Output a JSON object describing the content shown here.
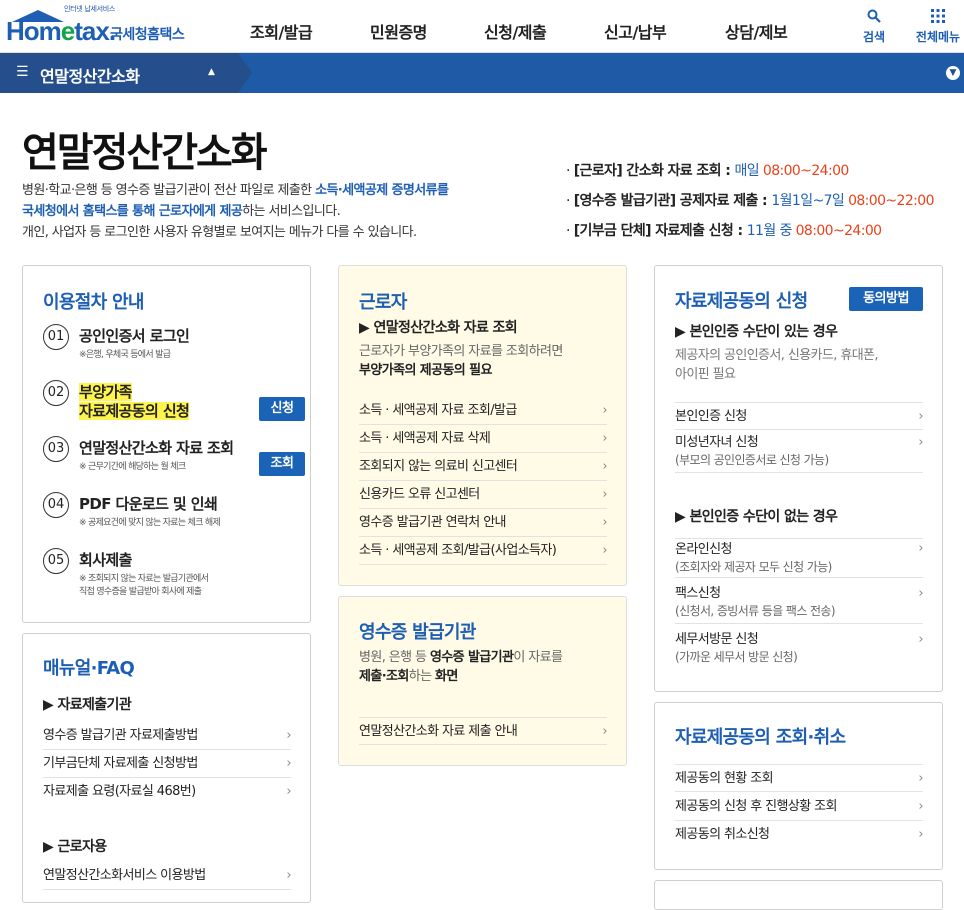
{
  "header": {
    "logo_small": "인터넷 납세서비스",
    "logo_brand_a": "Hom",
    "logo_brand_e": "e",
    "logo_brand_b": "tax.",
    "logo_kr": "국세청홈택스",
    "nav": [
      "조회/발급",
      "민원증명",
      "신청/제출",
      "신고/납부",
      "상담/제보"
    ],
    "search_label": "검색",
    "menu_label": "전체메뉴"
  },
  "location": {
    "title": "연말정산간소화"
  },
  "page": {
    "title": "연말정산간소화",
    "intro_1a": "병원·학교·은행 등 영수증 발급기관이 전산 파일로 제출한 ",
    "intro_1b": "소득·세액공제 증명서류를",
    "intro_2a": "국세청에서 홈택스를 통해 근로자에게 제공",
    "intro_2b": "하는 서비스입니다.",
    "intro_3": "개인, 사업자 등 로그인한 사용자 유형별로 보여지는 메뉴가 다를 수 있습니다."
  },
  "schedule": [
    {
      "label": "[근로자] 간소화 자료 조회 : ",
      "period": "매일 ",
      "time": "08:00~24:00"
    },
    {
      "label": "[영수증 발급기관] 공제자료 제출 : ",
      "period": "1월1일~7일 ",
      "time": "08:00~22:00"
    },
    {
      "label": "[기부금 단체] 자료제출 신청 : ",
      "period": "11월 중 ",
      "time": "08:00~24:00"
    }
  ],
  "procedure": {
    "title": "이용절차 안내",
    "steps": [
      {
        "num": "01",
        "title": "공인인증서 로그인",
        "note": "※은행, 우체국 등에서 발급"
      },
      {
        "num": "02",
        "title_1": "부양가족",
        "title_2": "자료제공동의 신청",
        "button": "신청"
      },
      {
        "num": "03",
        "title": "연말정산간소화 자료 조회",
        "note": "※ 근무기간에 해당하는 월 체크",
        "button": "조회"
      },
      {
        "num": "04",
        "title": "PDF 다운로드 및 인쇄",
        "note": "※ 공제요건에 맞지 않는 자료는 체크 해제"
      },
      {
        "num": "05",
        "title": "회사제출",
        "note_1": "※ 조회되지 않는 자료는 발급기관에서",
        "note_2": "직접 영수증을 발급받아 회사에 제출"
      }
    ]
  },
  "manual": {
    "title": "매뉴얼·FAQ",
    "sec1": "▶ 자료제출기관",
    "links1": [
      "영수증 발급기관 자료제출방법",
      "기부금단체 자료제출 신청방법",
      "자료제출 요령(자료실 468번)"
    ],
    "sec2": "▶ 근로자용",
    "links2": [
      "연말정산간소화서비스 이용방법"
    ]
  },
  "worker": {
    "title": "근로자",
    "sub": "▶ 연말정산간소화 자료 조회",
    "desc_1": "근로자가 부양가족의 자료를 조회하려면",
    "desc_2": "부양가족의 제공동의 필요",
    "links": [
      "소득 · 세액공제 자료 조회/발급",
      "소득 · 세액공제 자료 삭제",
      "조회되지 않는 의료비 신고센터",
      "신용카드 오류 신고센터",
      "영수증 발급기관 연락처 안내",
      "소득 · 세액공제 조회/발급(사업소득자)"
    ]
  },
  "issuer": {
    "title": "영수증 발급기관",
    "desc_1a": "병원, 은행 등 ",
    "desc_1b": "영수증 발급기관",
    "desc_1c": "이 자료를",
    "desc_2a": "제출·조회",
    "desc_2b": "하는 ",
    "desc_2c": "화면",
    "links": [
      "연말정산간소화 자료 제출 안내"
    ]
  },
  "consent": {
    "title": "자료제공동의 신청",
    "button": "동의방법",
    "sub1": "▶ 본인인증 수단이 있는 경우",
    "desc_1": "제공자의 공인인증서, 신용카드, 휴대폰,",
    "desc_2": "아이핀 필요",
    "links1": [
      {
        "label": "본인인증 신청"
      },
      {
        "label": "미성년자녀 신청",
        "note": "(부모의 공인인증서로 신청 가능)"
      }
    ],
    "sub2": "▶ 본인인증 수단이 없는 경우",
    "links2": [
      {
        "label": "온라인신청",
        "note": "(조회자와 제공자 모두 신청 가능)"
      },
      {
        "label": "팩스신청",
        "note": "(신청서, 증빙서류 등을 팩스 전송)"
      },
      {
        "label": "세무서방문 신청",
        "note": "(가까운 세무서 방문 신청)"
      }
    ]
  },
  "consent_lookup": {
    "title": "자료제공동의 조회·취소",
    "links": [
      "제공동의 현황 조회",
      "제공동의 신청 후 진행상황 조회",
      "제공동의 취소신청"
    ]
  },
  "arrow_glyph": "›"
}
